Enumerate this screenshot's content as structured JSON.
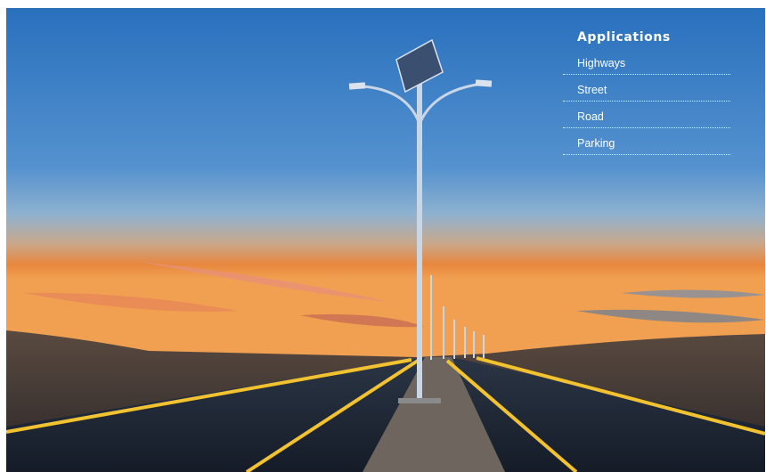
{
  "panel": {
    "title": "Applications",
    "items": [
      "Highways",
      "Street",
      "Road",
      "Parking"
    ]
  },
  "colors": {
    "sky_top": "#2a78c4",
    "sky_mid": "#4f8fd0",
    "horizon_orange": "#e7863e",
    "road": "#1b2433",
    "lane_yellow": "#f2c230",
    "pole": "#c9d6e6"
  }
}
